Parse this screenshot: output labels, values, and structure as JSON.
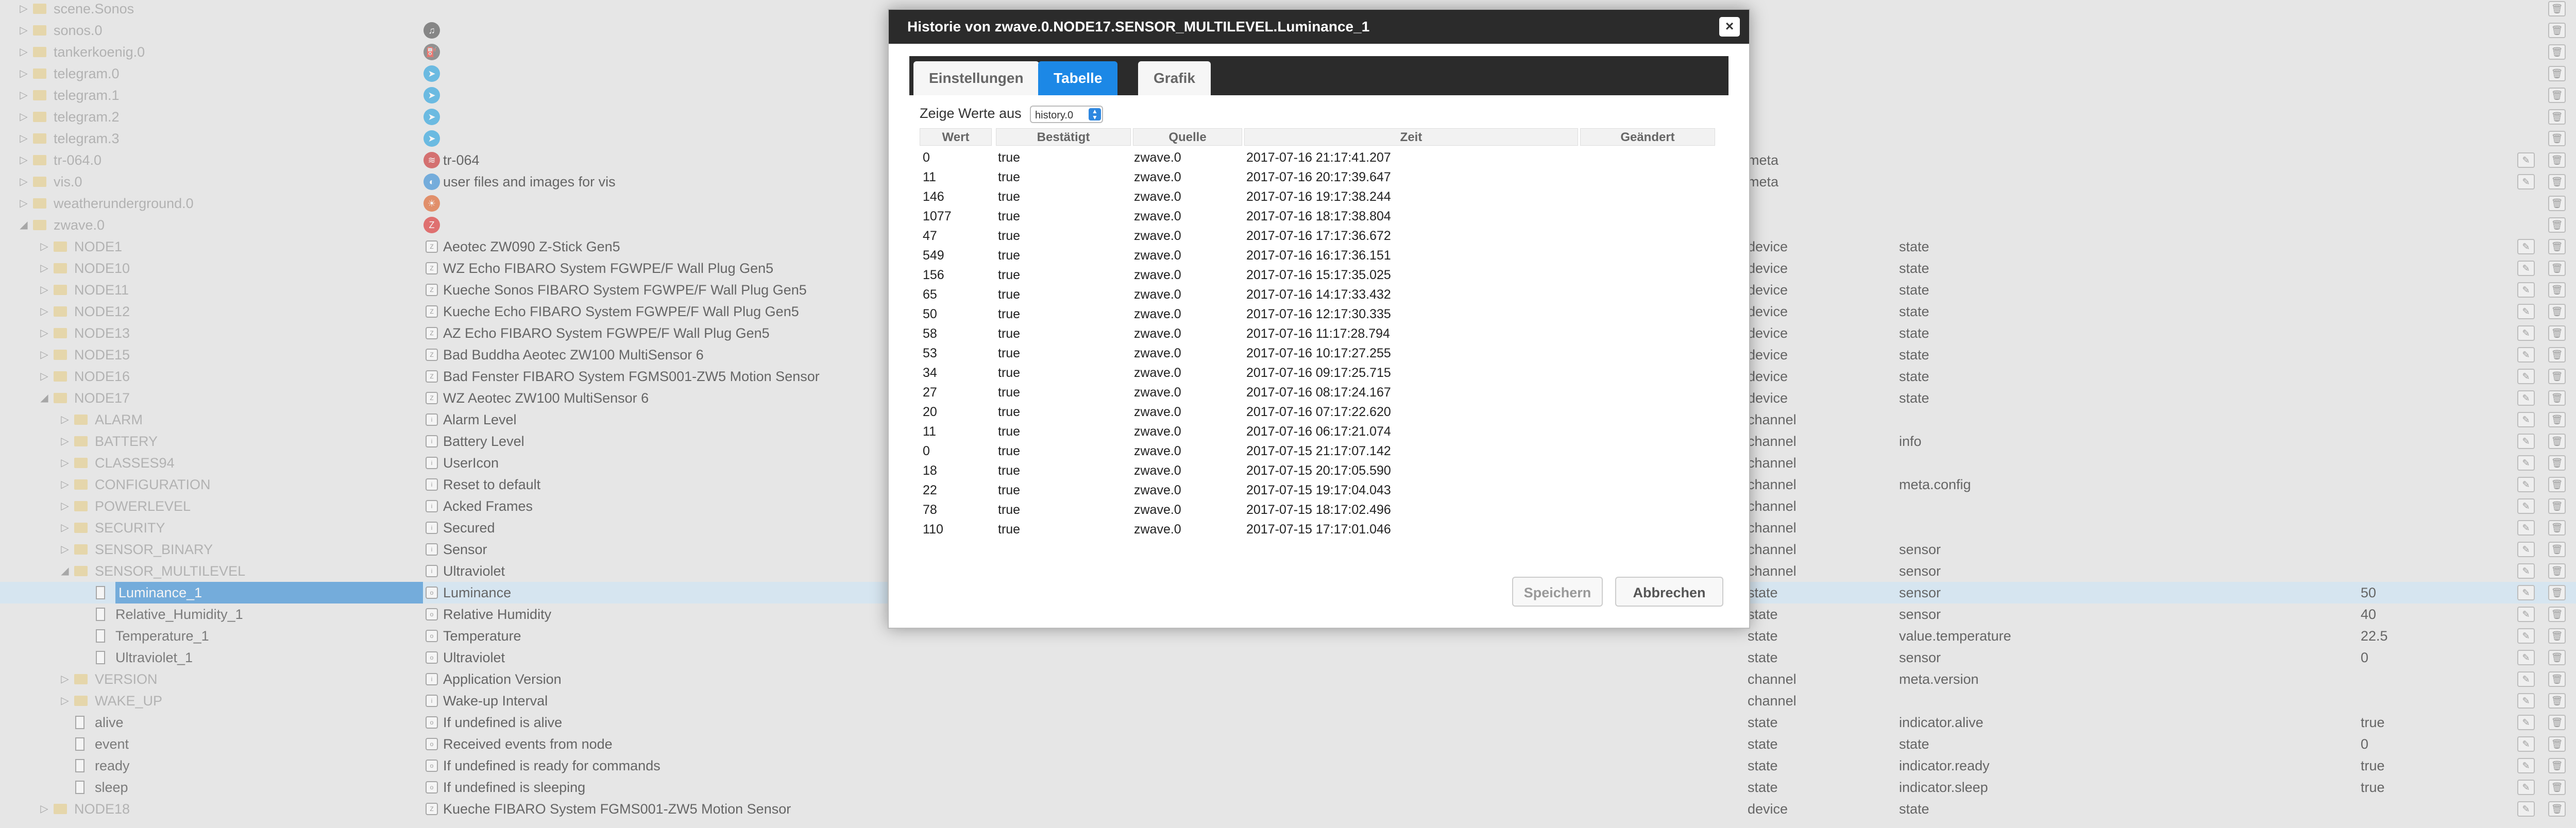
{
  "tree_rows": [
    {
      "name": "scene.Sonos",
      "indent": 0,
      "type": "folder",
      "light": true,
      "toggle": "▷"
    },
    {
      "name": "sonos.0",
      "indent": 0,
      "type": "folder",
      "light": true,
      "toggle": "▷",
      "icon": "sonos-icon"
    },
    {
      "name": "tankerkoenig.0",
      "indent": 0,
      "type": "folder",
      "light": true,
      "toggle": "▷",
      "icon": "fuel-icon"
    },
    {
      "name": "telegram.0",
      "indent": 0,
      "type": "folder",
      "light": true,
      "toggle": "▷",
      "icon": "telegram-icon"
    },
    {
      "name": "telegram.1",
      "indent": 0,
      "type": "folder",
      "light": true,
      "toggle": "▷",
      "icon": "telegram-icon"
    },
    {
      "name": "telegram.2",
      "indent": 0,
      "type": "folder",
      "light": true,
      "toggle": "▷",
      "icon": "telegram-icon"
    },
    {
      "name": "telegram.3",
      "indent": 0,
      "type": "folder",
      "light": true,
      "toggle": "▷",
      "icon": "telegram-icon"
    },
    {
      "name": "tr-064.0",
      "indent": 0,
      "type": "folder",
      "light": true,
      "toggle": "▷",
      "icon": "router-icon",
      "desc": "tr-064",
      "type_col": "meta",
      "edit": true
    },
    {
      "name": "vis.0",
      "indent": 0,
      "type": "folder",
      "light": true,
      "toggle": "▷",
      "icon": "vis-icon",
      "desc": "user files and images for vis",
      "type_col": "meta",
      "edit": true
    },
    {
      "name": "weatherunderground.0",
      "indent": 0,
      "type": "folder",
      "light": true,
      "toggle": "▷",
      "icon": "weather-icon"
    },
    {
      "name": "zwave.0",
      "indent": 0,
      "type": "folder",
      "light": true,
      "toggle": "◢",
      "icon": "zwave-icon"
    },
    {
      "name": "NODE1",
      "indent": 1,
      "type": "folder",
      "light": true,
      "toggle": "▷",
      "sq": "Z",
      "desc": "Aeotec ZW090 Z-Stick Gen5",
      "type_col": "device",
      "role": "state",
      "edit": true
    },
    {
      "name": "NODE10",
      "indent": 1,
      "type": "folder",
      "light": true,
      "toggle": "▷",
      "sq": "Z",
      "desc": "WZ Echo FIBARO System FGWPE/F Wall Plug Gen5",
      "type_col": "device",
      "role": "state",
      "edit": true
    },
    {
      "name": "NODE11",
      "indent": 1,
      "type": "folder",
      "light": true,
      "toggle": "▷",
      "sq": "Z",
      "desc": "Kueche Sonos FIBARO System FGWPE/F Wall Plug Gen5",
      "type_col": "device",
      "role": "state",
      "edit": true
    },
    {
      "name": "NODE12",
      "indent": 1,
      "type": "folder",
      "light": true,
      "toggle": "▷",
      "sq": "Z",
      "desc": "Kueche Echo FIBARO System FGWPE/F Wall Plug Gen5",
      "type_col": "device",
      "role": "state",
      "edit": true
    },
    {
      "name": "NODE13",
      "indent": 1,
      "type": "folder",
      "light": true,
      "toggle": "▷",
      "sq": "Z",
      "desc": "AZ Echo FIBARO System FGWPE/F Wall Plug Gen5",
      "type_col": "device",
      "role": "state",
      "edit": true
    },
    {
      "name": "NODE15",
      "indent": 1,
      "type": "folder",
      "light": true,
      "toggle": "▷",
      "sq": "Z",
      "desc": "Bad Buddha Aeotec ZW100 MultiSensor 6",
      "type_col": "device",
      "role": "state",
      "edit": true
    },
    {
      "name": "NODE16",
      "indent": 1,
      "type": "folder",
      "light": true,
      "toggle": "▷",
      "sq": "Z",
      "desc": "Bad Fenster FIBARO System FGMS001-ZW5 Motion Sensor",
      "type_col": "device",
      "role": "state",
      "edit": true
    },
    {
      "name": "NODE17",
      "indent": 1,
      "type": "folder",
      "light": true,
      "toggle": "◢",
      "sq": "Z",
      "desc": "WZ Aeotec ZW100 MultiSensor 6",
      "type_col": "device",
      "role": "state",
      "edit": true
    },
    {
      "name": "ALARM",
      "indent": 2,
      "type": "folder",
      "light": true,
      "toggle": "▷",
      "sq": "i",
      "desc": "Alarm Level",
      "type_col": "channel",
      "edit": true
    },
    {
      "name": "BATTERY",
      "indent": 2,
      "type": "folder",
      "light": true,
      "toggle": "▷",
      "sq": "i",
      "desc": "Battery Level",
      "type_col": "channel",
      "role": "info",
      "edit": true
    },
    {
      "name": "CLASSES94",
      "indent": 2,
      "type": "folder",
      "light": true,
      "toggle": "▷",
      "sq": "i",
      "desc": "UserIcon",
      "type_col": "channel",
      "edit": true
    },
    {
      "name": "CONFIGURATION",
      "indent": 2,
      "type": "folder",
      "light": true,
      "toggle": "▷",
      "sq": "i",
      "desc": "Reset to default",
      "type_col": "channel",
      "role": "meta.config",
      "edit": true
    },
    {
      "name": "POWERLEVEL",
      "indent": 2,
      "type": "folder",
      "light": true,
      "toggle": "▷",
      "sq": "i",
      "desc": "Acked Frames",
      "type_col": "channel",
      "edit": true
    },
    {
      "name": "SECURITY",
      "indent": 2,
      "type": "folder",
      "light": true,
      "toggle": "▷",
      "sq": "i",
      "desc": "Secured",
      "type_col": "channel",
      "edit": true
    },
    {
      "name": "SENSOR_BINARY",
      "indent": 2,
      "type": "folder",
      "light": true,
      "toggle": "▷",
      "sq": "i",
      "desc": "Sensor",
      "type_col": "channel",
      "role": "sensor",
      "edit": true
    },
    {
      "name": "SENSOR_MULTILEVEL",
      "indent": 2,
      "type": "folder",
      "light": true,
      "toggle": "◢",
      "sq": "i",
      "desc": "Ultraviolet",
      "type_col": "channel",
      "role": "sensor",
      "edit": true
    },
    {
      "name": "Luminance_1",
      "indent": 3,
      "type": "file",
      "selected": true,
      "sq": "o",
      "desc": "Luminance",
      "type_col": "state",
      "role": "sensor",
      "value": "50",
      "edit": true,
      "hist": true
    },
    {
      "name": "Relative_Humidity_1",
      "indent": 3,
      "type": "file",
      "sq": "o",
      "desc": "Relative Humidity",
      "type_col": "state",
      "role": "sensor",
      "value": "40",
      "edit": true,
      "hist": true
    },
    {
      "name": "Temperature_1",
      "indent": 3,
      "type": "file",
      "sq": "o",
      "desc": "Temperature",
      "type_col": "state",
      "role": "value.temperature",
      "value": "22.5",
      "edit": true,
      "hist": true
    },
    {
      "name": "Ultraviolet_1",
      "indent": 3,
      "type": "file",
      "sq": "o",
      "desc": "Ultraviolet",
      "type_col": "state",
      "role": "sensor",
      "value": "0",
      "edit": true,
      "hist": true
    },
    {
      "name": "VERSION",
      "indent": 2,
      "type": "folder",
      "light": true,
      "toggle": "▷",
      "sq": "i",
      "desc": "Application Version",
      "type_col": "channel",
      "role": "meta.version",
      "edit": true
    },
    {
      "name": "WAKE_UP",
      "indent": 2,
      "type": "folder",
      "light": true,
      "toggle": "▷",
      "sq": "i",
      "desc": "Wake-up Interval",
      "type_col": "channel",
      "edit": true
    },
    {
      "name": "alive",
      "indent": 2,
      "type": "file",
      "sq": "o",
      "desc": "If undefined is alive",
      "type_col": "state",
      "role": "indicator.alive",
      "value": "true",
      "edit": true,
      "gear": true
    },
    {
      "name": "event",
      "indent": 2,
      "type": "file",
      "sq": "o",
      "desc": "Received events from node",
      "type_col": "state",
      "role": "state",
      "value": "0",
      "edit": true,
      "gear": true
    },
    {
      "name": "ready",
      "indent": 2,
      "type": "file",
      "sq": "o",
      "desc": "If undefined is ready for commands",
      "type_col": "state",
      "role": "indicator.ready",
      "value": "true",
      "edit": true,
      "gear": true
    },
    {
      "name": "sleep",
      "indent": 2,
      "type": "file",
      "sq": "o",
      "desc": "If undefined is sleeping",
      "type_col": "state",
      "role": "indicator.sleep",
      "value": "true",
      "edit": true,
      "gear": true
    },
    {
      "name": "NODE18",
      "indent": 1,
      "type": "folder",
      "light": true,
      "toggle": "▷",
      "sq": "Z",
      "desc": "Kueche FIBARO System FGMS001-ZW5 Motion Sensor",
      "type_col": "device",
      "role": "state",
      "edit": true
    }
  ],
  "dialog": {
    "title": "Historie von zwave.0.NODE17.SENSOR_MULTILEVEL.Luminance_1",
    "close_label": "×",
    "tabs": [
      {
        "label": "Einstellungen",
        "active": false
      },
      {
        "label": "Tabelle",
        "active": true
      },
      {
        "label": "Grafik",
        "active": false
      }
    ],
    "instance_label": "Zeige Werte aus",
    "instance_value": "history.0",
    "columns": [
      "Wert",
      "Bestätigt",
      "Quelle",
      "Zeit",
      "Geändert"
    ],
    "rows": [
      [
        "0",
        "true",
        "zwave.0",
        "2017-07-16 21:17:41.207",
        ""
      ],
      [
        "11",
        "true",
        "zwave.0",
        "2017-07-16 20:17:39.647",
        ""
      ],
      [
        "146",
        "true",
        "zwave.0",
        "2017-07-16 19:17:38.244",
        ""
      ],
      [
        "1077",
        "true",
        "zwave.0",
        "2017-07-16 18:17:38.804",
        ""
      ],
      [
        "47",
        "true",
        "zwave.0",
        "2017-07-16 17:17:36.672",
        ""
      ],
      [
        "549",
        "true",
        "zwave.0",
        "2017-07-16 16:17:36.151",
        ""
      ],
      [
        "156",
        "true",
        "zwave.0",
        "2017-07-16 15:17:35.025",
        ""
      ],
      [
        "65",
        "true",
        "zwave.0",
        "2017-07-16 14:17:33.432",
        ""
      ],
      [
        "50",
        "true",
        "zwave.0",
        "2017-07-16 12:17:30.335",
        ""
      ],
      [
        "58",
        "true",
        "zwave.0",
        "2017-07-16 11:17:28.794",
        ""
      ],
      [
        "53",
        "true",
        "zwave.0",
        "2017-07-16 10:17:27.255",
        ""
      ],
      [
        "34",
        "true",
        "zwave.0",
        "2017-07-16 09:17:25.715",
        ""
      ],
      [
        "27",
        "true",
        "zwave.0",
        "2017-07-16 08:17:24.167",
        ""
      ],
      [
        "20",
        "true",
        "zwave.0",
        "2017-07-16 07:17:22.620",
        ""
      ],
      [
        "11",
        "true",
        "zwave.0",
        "2017-07-16 06:17:21.074",
        ""
      ],
      [
        "0",
        "true",
        "zwave.0",
        "2017-07-15 21:17:07.142",
        ""
      ],
      [
        "18",
        "true",
        "zwave.0",
        "2017-07-15 20:17:05.590",
        ""
      ],
      [
        "22",
        "true",
        "zwave.0",
        "2017-07-15 19:17:04.043",
        ""
      ],
      [
        "78",
        "true",
        "zwave.0",
        "2017-07-15 18:17:02.496",
        ""
      ],
      [
        "110",
        "true",
        "zwave.0",
        "2017-07-15 17:17:01.046",
        ""
      ]
    ],
    "save_label": "Speichern",
    "cancel_label": "Abbrechen"
  },
  "colors": {
    "accent": "#1c88e6",
    "title_bar": "#2b2b2b",
    "selected_row": "#cfe6f7",
    "folder": "#d8b050"
  }
}
